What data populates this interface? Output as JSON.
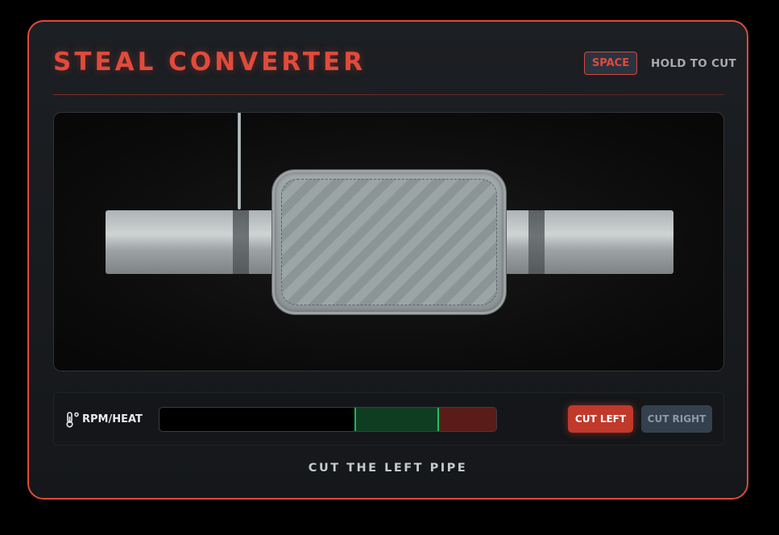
{
  "game": {
    "title": "STEAL CONVERTER"
  },
  "controls_hint": {
    "key": "SPACE",
    "action": "HOLD TO CUT"
  },
  "gauge": {
    "label": "RPM/HEAT",
    "icon": "thermometer-icon",
    "level": 0.0,
    "green_zone": [
      0.58,
      0.825
    ],
    "red_zone": [
      0.825,
      1.0
    ]
  },
  "buttons": {
    "cut_left": "CUT LEFT",
    "cut_right": "CUT RIGHT",
    "active": "cut_left"
  },
  "status": "CUT THE LEFT PIPE",
  "colors": {
    "accent": "#e24a3b",
    "good_zone": "#0f3d22",
    "danger_zone": "#5a1c18",
    "button_active": "#c0392b",
    "button_inactive": "#34404e"
  }
}
